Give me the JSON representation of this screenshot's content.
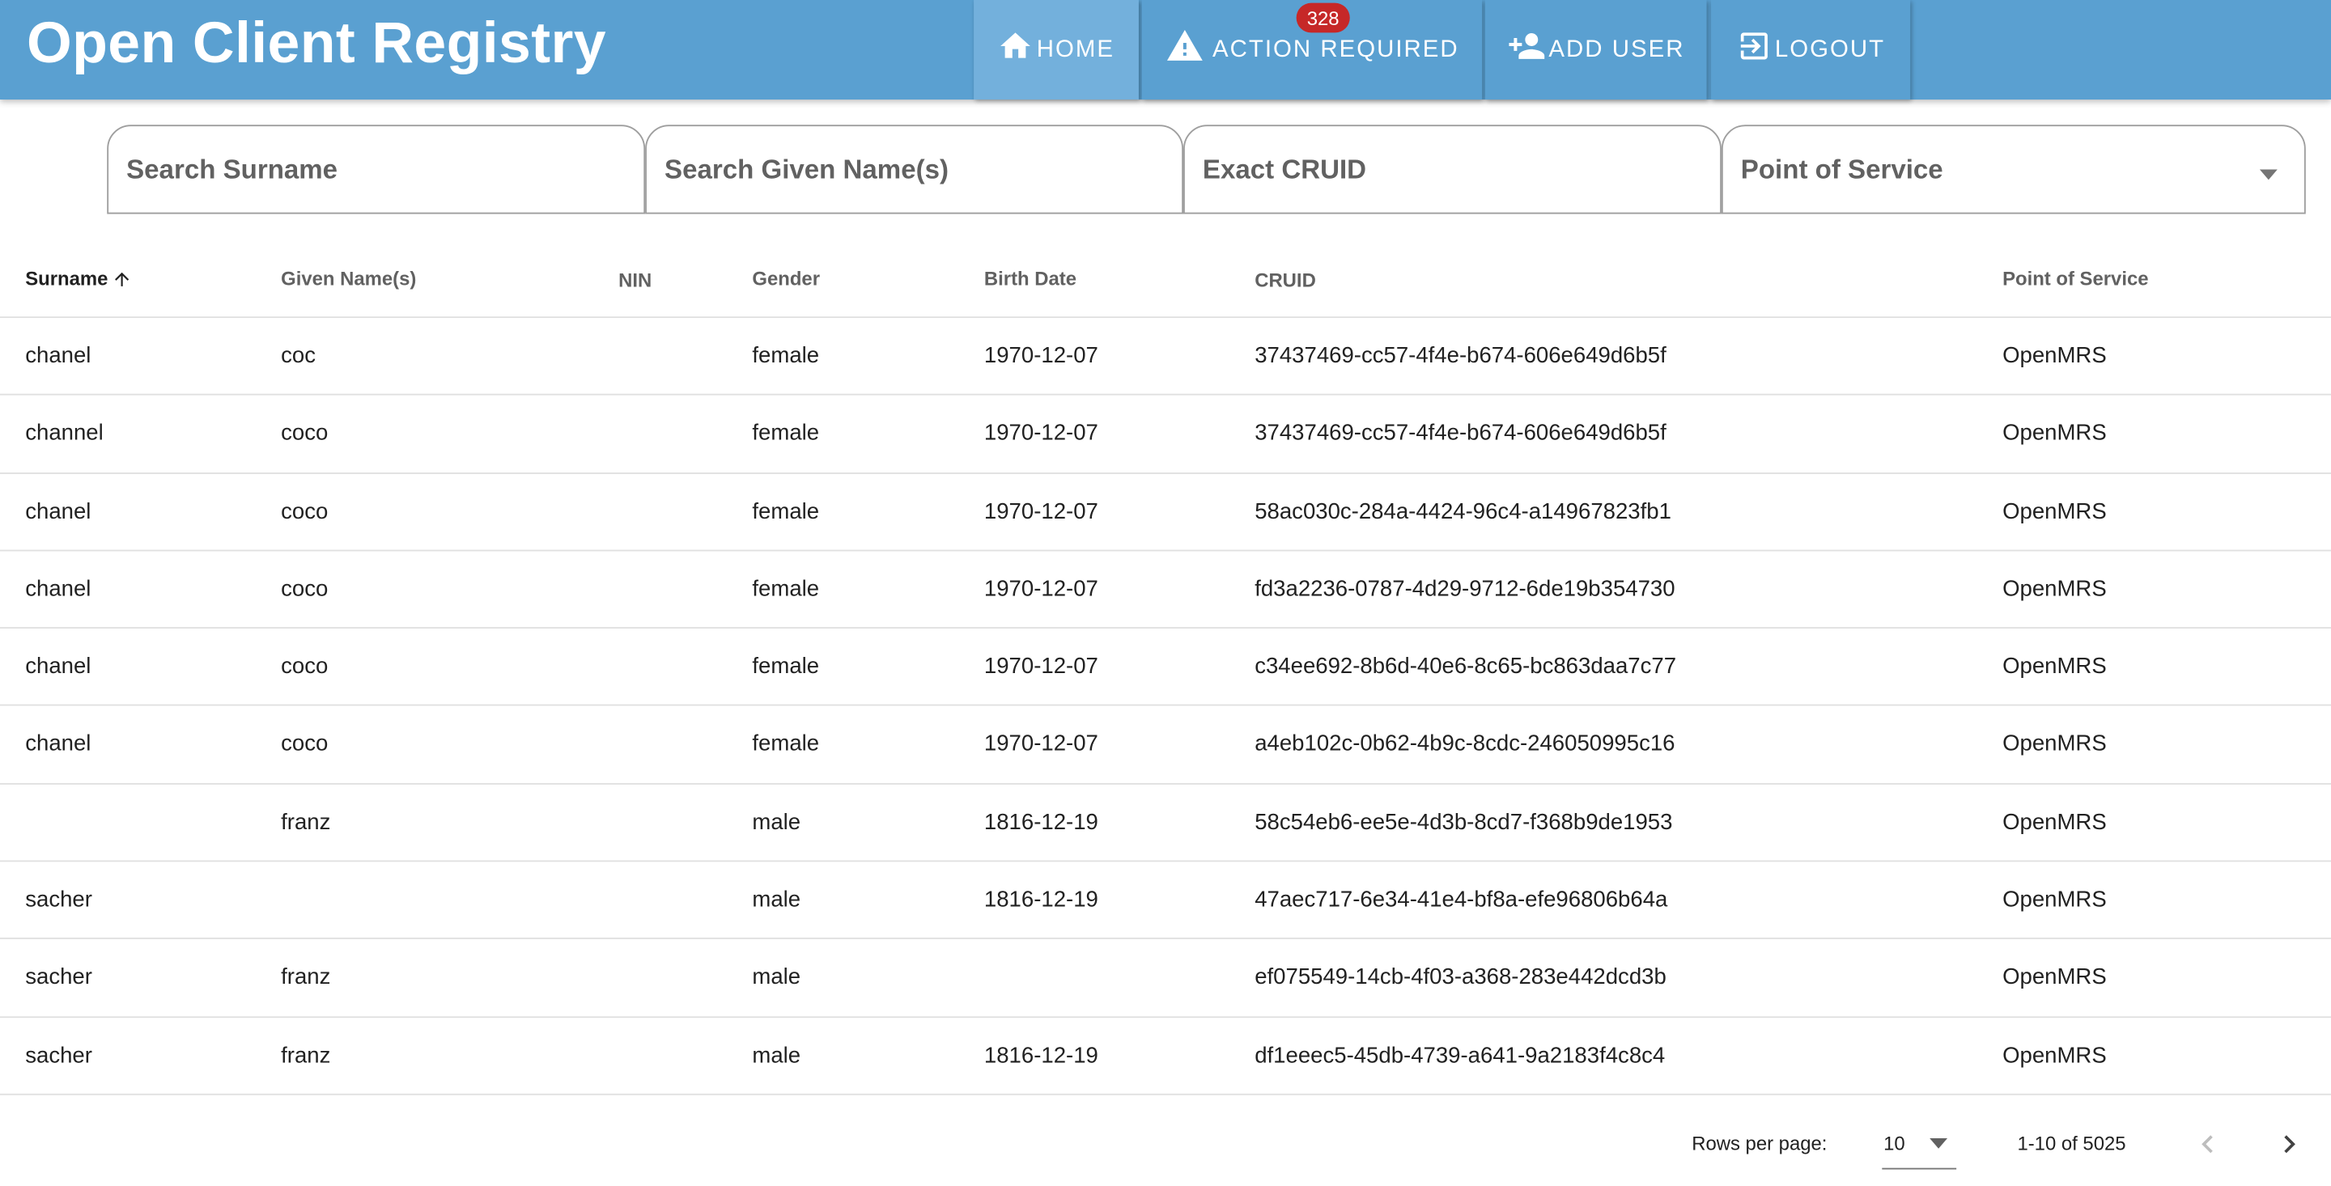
{
  "app": {
    "title": "Open Client Registry"
  },
  "nav": {
    "home": "HOME",
    "action_required": "ACTION REQUIRED",
    "action_required_count": "328",
    "add_user": "ADD USER",
    "logout": "LOGOUT"
  },
  "search": {
    "surname_placeholder": "Search Surname",
    "given_placeholder": "Search Given Name(s)",
    "cruid_placeholder": "Exact CRUID",
    "pos_label": "Point of Service"
  },
  "table": {
    "columns": [
      "Surname",
      "Given Name(s)",
      "NIN",
      "Gender",
      "Birth Date",
      "CRUID",
      "Point of Service"
    ],
    "sorted_by": "Surname",
    "sort_direction": "ascending",
    "rows": [
      {
        "surname": "chanel",
        "given": "coc",
        "nin": "",
        "gender": "female",
        "birth": "1970-12-07",
        "cruid": "37437469-cc57-4f4e-b674-606e649d6b5f",
        "pos": "OpenMRS"
      },
      {
        "surname": "channel",
        "given": "coco",
        "nin": "",
        "gender": "female",
        "birth": "1970-12-07",
        "cruid": "37437469-cc57-4f4e-b674-606e649d6b5f",
        "pos": "OpenMRS"
      },
      {
        "surname": "chanel",
        "given": "coco",
        "nin": "",
        "gender": "female",
        "birth": "1970-12-07",
        "cruid": "58ac030c-284a-4424-96c4-a14967823fb1",
        "pos": "OpenMRS"
      },
      {
        "surname": "chanel",
        "given": "coco",
        "nin": "",
        "gender": "female",
        "birth": "1970-12-07",
        "cruid": "fd3a2236-0787-4d29-9712-6de19b354730",
        "pos": "OpenMRS"
      },
      {
        "surname": "chanel",
        "given": "coco",
        "nin": "",
        "gender": "female",
        "birth": "1970-12-07",
        "cruid": "c34ee692-8b6d-40e6-8c65-bc863daa7c77",
        "pos": "OpenMRS"
      },
      {
        "surname": "chanel",
        "given": "coco",
        "nin": "",
        "gender": "female",
        "birth": "1970-12-07",
        "cruid": "a4eb102c-0b62-4b9c-8cdc-246050995c16",
        "pos": "OpenMRS"
      },
      {
        "surname": "",
        "given": "franz",
        "nin": "",
        "gender": "male",
        "birth": "1816-12-19",
        "cruid": "58c54eb6-ee5e-4d3b-8cd7-f368b9de1953",
        "pos": "OpenMRS"
      },
      {
        "surname": "sacher",
        "given": "",
        "nin": "",
        "gender": "male",
        "birth": "1816-12-19",
        "cruid": "47aec717-6e34-41e4-bf8a-efe96806b64a",
        "pos": "OpenMRS"
      },
      {
        "surname": "sacher",
        "given": "franz",
        "nin": "",
        "gender": "male",
        "birth": "",
        "cruid": "ef075549-14cb-4f03-a368-283e442dcd3b",
        "pos": "OpenMRS"
      },
      {
        "surname": "sacher",
        "given": "franz",
        "nin": "",
        "gender": "male",
        "birth": "1816-12-19",
        "cruid": "df1eeec5-45db-4739-a641-9a2183f4c8c4",
        "pos": "OpenMRS"
      }
    ]
  },
  "footer": {
    "rows_per_page_label": "Rows per page:",
    "rows_per_page_value": "10",
    "range_text": "1-10 of 5025"
  },
  "icons": {
    "home": "home-icon",
    "action_required": "warning-icon",
    "add_user": "person-add-icon",
    "logout": "logout-icon",
    "sort": "arrow-up-icon",
    "dropdown": "caret-down-icon",
    "prev": "chevron-left-icon",
    "next": "chevron-right-icon"
  },
  "colors": {
    "appbar": "#5aa0d1",
    "appbar_active": "#73b0dc",
    "badge": "#c62828",
    "text": "#212121",
    "muted_text": "#616161"
  }
}
